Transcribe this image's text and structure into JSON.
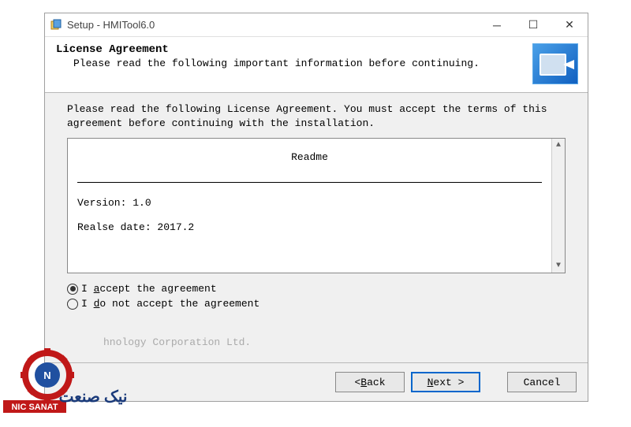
{
  "titlebar": {
    "title": "Setup - HMITool6.0"
  },
  "header": {
    "title": "License Agreement",
    "subtitle": "Please read the following important information before continuing."
  },
  "body": {
    "instruction": "Please read the following License Agreement. You must accept the terms of this agreement before continuing with the installation."
  },
  "license": {
    "readme_title": "Readme",
    "version_line": "Version: 1.0",
    "release_line": "Realse date: 2017.2"
  },
  "radios": {
    "accept_prefix": "I ",
    "accept_u": "a",
    "accept_rest": "ccept the agreement",
    "reject_prefix": "I ",
    "reject_u": "d",
    "reject_rest": "o not accept the agreement"
  },
  "footer_text": "hnology Corporation Ltd.",
  "buttons": {
    "back_lt": "< ",
    "back_u": "B",
    "back_rest": "ack",
    "next_u": "N",
    "next_rest": "ext >",
    "cancel": "Cancel"
  },
  "watermark": {
    "brand": "NIC SANAT",
    "brand_fa": "نیک صنعت"
  }
}
